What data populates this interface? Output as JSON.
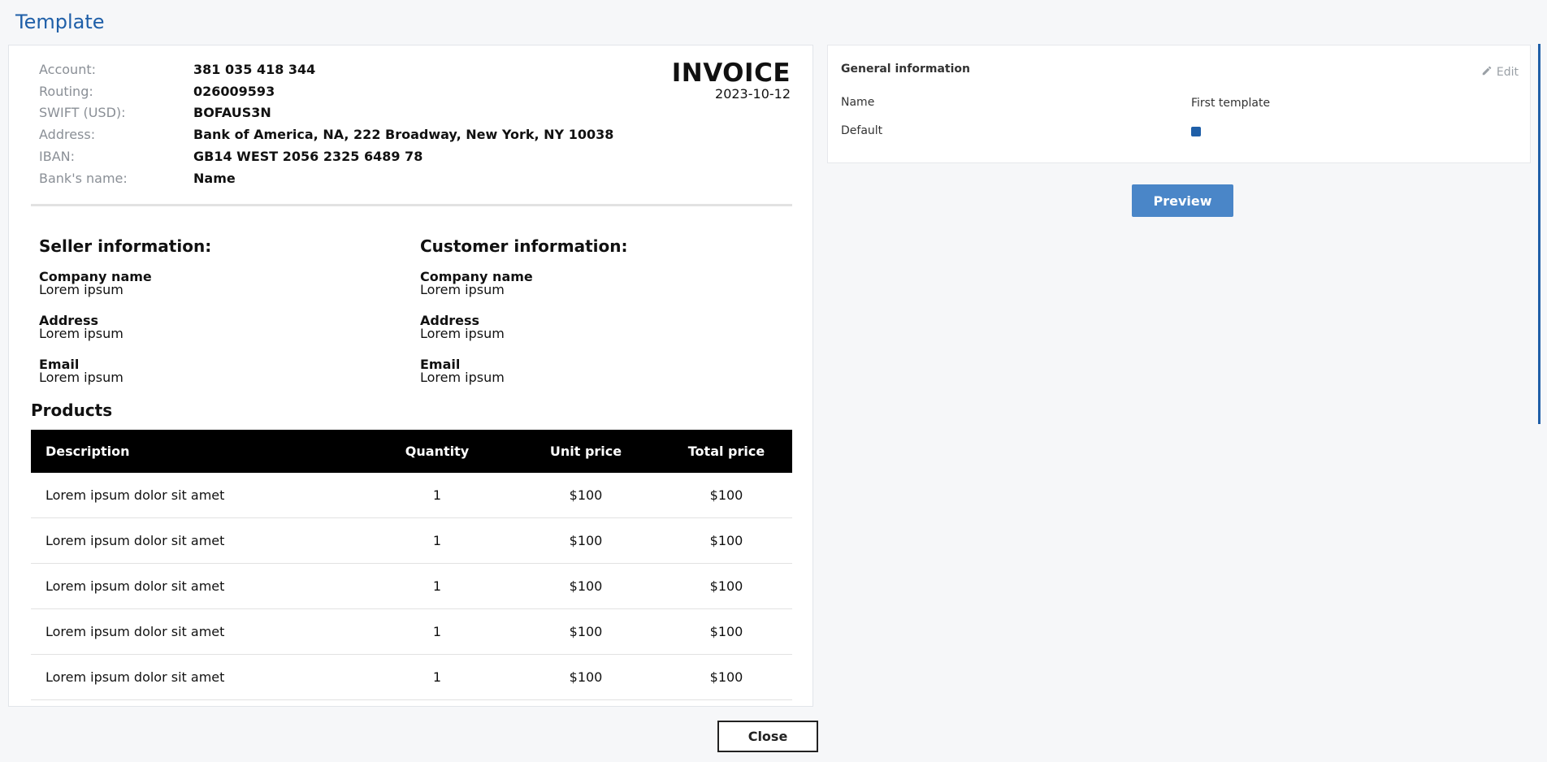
{
  "page_title": "Template",
  "invoice": {
    "bank_details": [
      {
        "label": "Account:",
        "value": "381 035 418 344"
      },
      {
        "label": "Routing:",
        "value": "026009593"
      },
      {
        "label": "SWIFT (USD):",
        "value": "BOFAUS3N"
      },
      {
        "label": "Address:",
        "value": "Bank of America, NA, 222 Broadway, New York, NY 10038"
      },
      {
        "label": "IBAN:",
        "value": "GB14 WEST 2056 2325 6489 78"
      },
      {
        "label": "Bank's name:",
        "value": "Name"
      }
    ],
    "title": "INVOICE",
    "date": "2023-10-12",
    "seller": {
      "heading": "Seller information:",
      "company_label": "Company name",
      "company_value": "Lorem ipsum",
      "address_label": "Address",
      "address_value": "Lorem ipsum",
      "email_label": "Email",
      "email_value": "Lorem ipsum"
    },
    "customer": {
      "heading": "Customer information:",
      "company_label": "Company name",
      "company_value": "Lorem ipsum",
      "address_label": "Address",
      "address_value": "Lorem ipsum",
      "email_label": "Email",
      "email_value": "Lorem ipsum"
    },
    "products_title": "Products",
    "products_columns": [
      "Description",
      "Quantity",
      "Unit price",
      "Total price"
    ],
    "products_rows": [
      [
        "Lorem ipsum dolor sit amet",
        "1",
        "$100",
        "$100"
      ],
      [
        "Lorem ipsum dolor sit amet",
        "1",
        "$100",
        "$100"
      ],
      [
        "Lorem ipsum dolor sit amet",
        "1",
        "$100",
        "$100"
      ],
      [
        "Lorem ipsum dolor sit amet",
        "1",
        "$100",
        "$100"
      ],
      [
        "Lorem ipsum dolor sit amet",
        "1",
        "$100",
        "$100"
      ]
    ]
  },
  "general_info": {
    "title": "General information",
    "edit_label": "Edit",
    "name_label": "Name",
    "name_value": "First template",
    "default_label": "Default",
    "default_checked": true
  },
  "preview_label": "Preview",
  "close_label": "Close",
  "colors": {
    "accent": "#1f5fa8",
    "button_primary": "#4a86c8",
    "table_header_bg": "#000000"
  },
  "icons": {
    "edit": "pencil-icon"
  }
}
